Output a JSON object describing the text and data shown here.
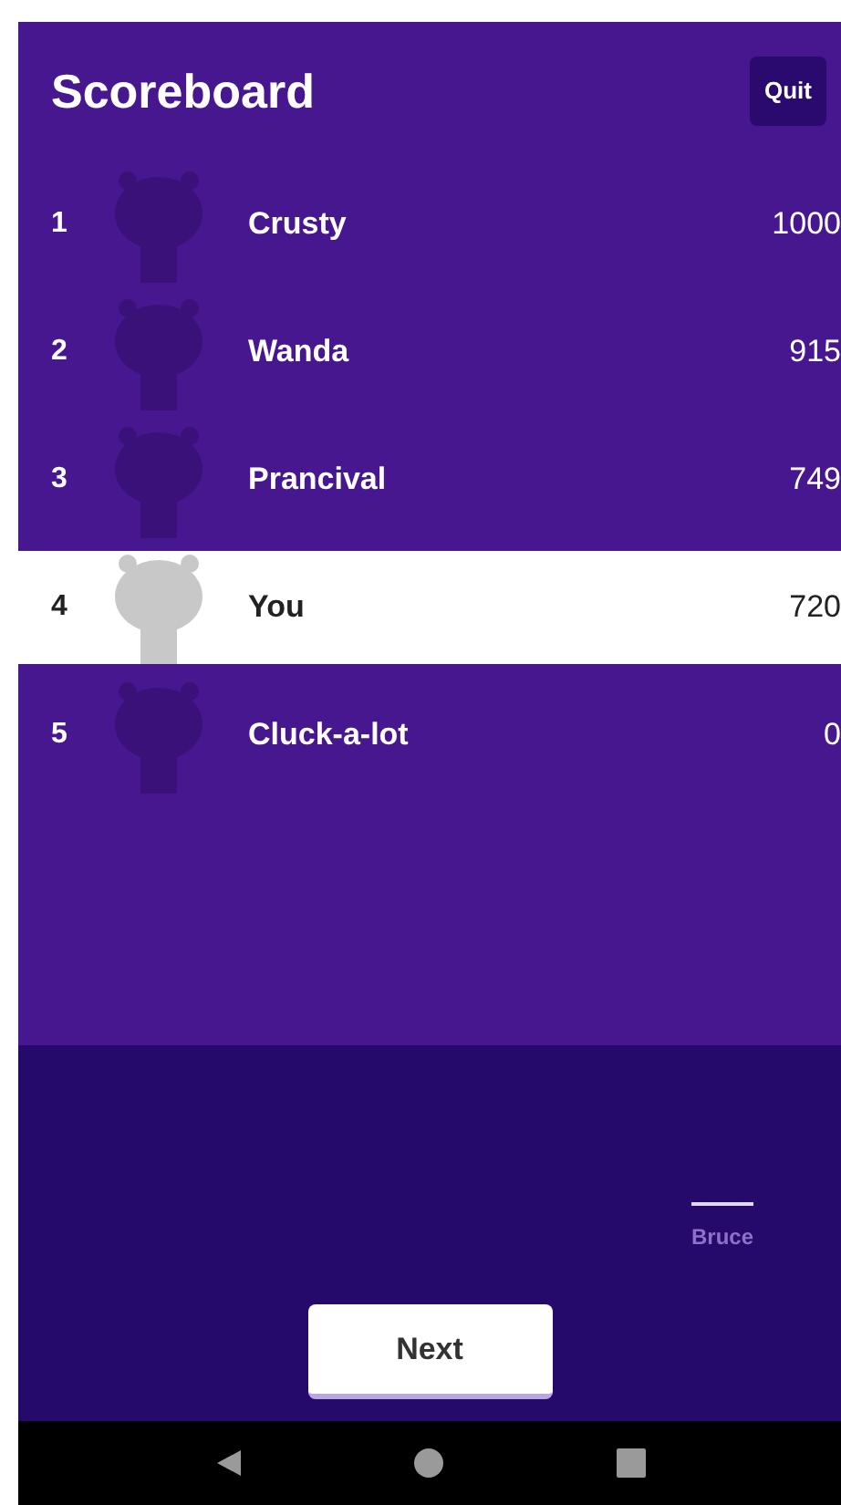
{
  "header": {
    "title": "Scoreboard",
    "quit_button": "Quit"
  },
  "rows": [
    {
      "rank": "1",
      "name": "Crusty",
      "score": "1000",
      "highlighted": false
    },
    {
      "rank": "2",
      "name": "Wanda",
      "score": "915",
      "highlighted": false
    },
    {
      "rank": "3",
      "name": "Prancival",
      "score": "749",
      "highlighted": false
    },
    {
      "rank": "4",
      "name": "You",
      "score": "720",
      "highlighted": true
    },
    {
      "rank": "5",
      "name": "Cluck-a-lot",
      "score": "0",
      "highlighted": false
    }
  ],
  "footer": {
    "tab_label": "Bruce",
    "next_button": "Next"
  }
}
